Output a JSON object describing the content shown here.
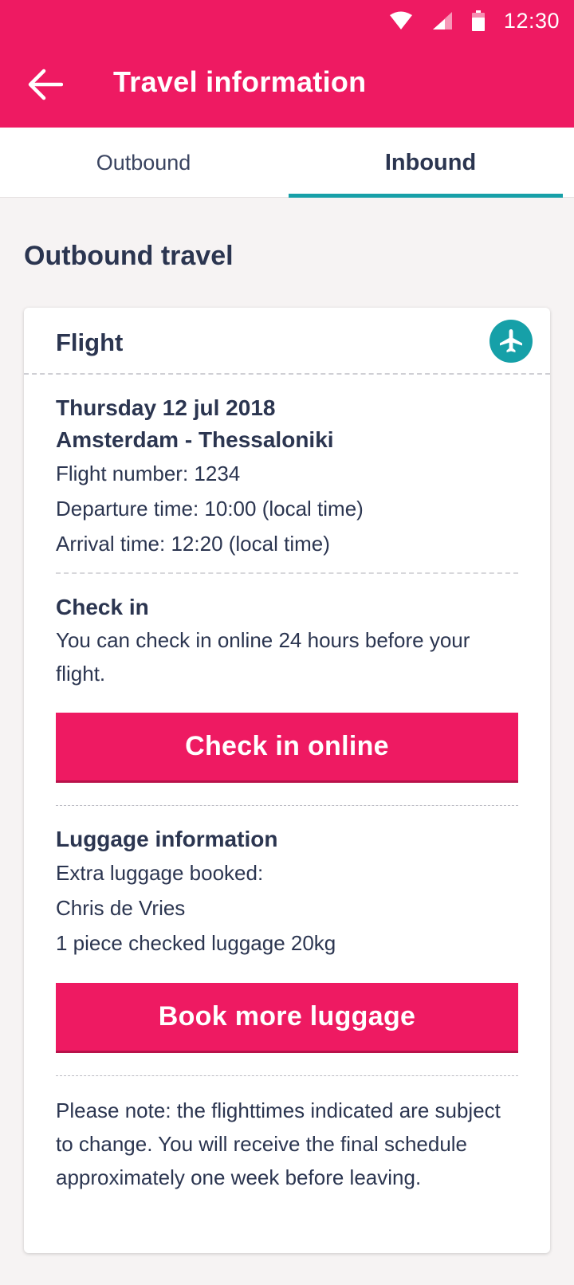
{
  "status_bar": {
    "time": "12:30",
    "icons": [
      "wifi-icon",
      "signal-icon",
      "battery-icon"
    ]
  },
  "app_bar": {
    "back_icon": "arrow-left-icon",
    "title": "Travel information"
  },
  "tabs": [
    {
      "label": "Outbound",
      "active": false
    },
    {
      "label": "Inbound",
      "active": true
    }
  ],
  "section_title": "Outbound travel",
  "card": {
    "title": "Flight",
    "icon": "plane-icon",
    "date": "Thursday 12 jul 2018",
    "route": "Amsterdam - Thessaloniki",
    "flight_number": "Flight number: 1234",
    "departure": "Departure time: 10:00  (local time)",
    "arrival": "Arrival time: 12:20 (local time)",
    "checkin": {
      "heading": "Check in",
      "text": "You can check in online 24 hours before your flight.",
      "button": "Check in online"
    },
    "luggage": {
      "heading": "Luggage information",
      "lines": [
        "Extra luggage booked:",
        "Chris de Vries",
        "1 piece checked luggage 20kg"
      ],
      "button": "Book more luggage"
    },
    "note": "Please note: the flighttimes indicated are subject to change. You will receive the final schedule approximately one week before leaving."
  },
  "colors": {
    "brand_pink": "#ee1a62",
    "accent_teal": "#17a0a8",
    "text_navy": "#2b3550",
    "background": "#f6f3f3"
  }
}
